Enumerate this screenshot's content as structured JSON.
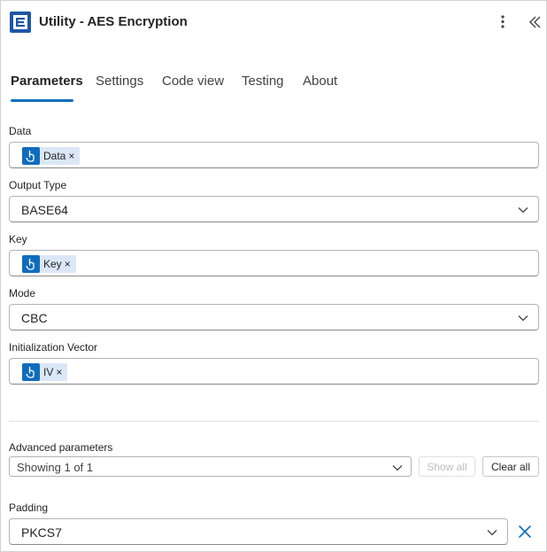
{
  "header": {
    "title": "Utility - AES Encryption",
    "icon": "app-logo-icon",
    "accent": "#1f56a8"
  },
  "tabs": [
    {
      "label": "Parameters",
      "active": true
    },
    {
      "label": "Settings",
      "active": false
    },
    {
      "label": "Code view",
      "active": false
    },
    {
      "label": "Testing",
      "active": false
    },
    {
      "label": "About",
      "active": false
    }
  ],
  "fields": {
    "data": {
      "label": "Data",
      "token": "Data",
      "remove": "×"
    },
    "output_type": {
      "label": "Output Type",
      "value": "BASE64"
    },
    "key": {
      "label": "Key",
      "token": "Key",
      "remove": "×"
    },
    "mode": {
      "label": "Mode",
      "value": "CBC"
    },
    "iv": {
      "label": "Initialization Vector",
      "token": "IV",
      "remove": "×"
    }
  },
  "advanced": {
    "label": "Advanced parameters",
    "value": "Showing 1 of 1",
    "show_all": "Show all",
    "clear_all": "Clear all"
  },
  "padding": {
    "label": "Padding",
    "value": "PKCS7"
  },
  "colors": {
    "token_bg": "#dbe7f7",
    "token_icon": "#0f6cbd",
    "active_tab": "#0f6cbd"
  }
}
